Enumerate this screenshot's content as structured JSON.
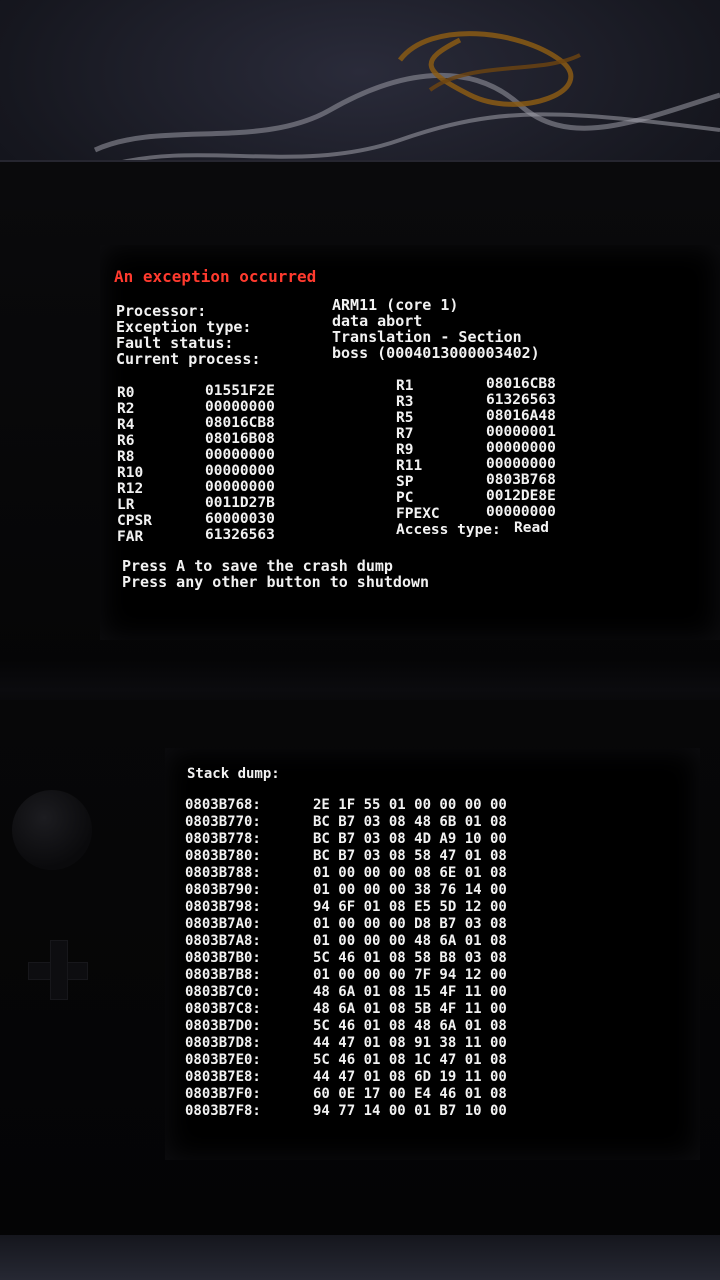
{
  "top_screen": {
    "title": "An exception occurred",
    "info": [
      {
        "label": "Processor:",
        "value": "ARM11 (core 1)"
      },
      {
        "label": "Exception type:",
        "value": "data abort"
      },
      {
        "label": "Fault status:",
        "value": "Translation - Section"
      },
      {
        "label": "Current process:",
        "value": "boss (0004013000003402)"
      }
    ],
    "registers_left": [
      {
        "name": "R0",
        "value": "01551F2E"
      },
      {
        "name": "R2",
        "value": "00000000"
      },
      {
        "name": "R4",
        "value": "08016CB8"
      },
      {
        "name": "R6",
        "value": "08016B08"
      },
      {
        "name": "R8",
        "value": "00000000"
      },
      {
        "name": "R10",
        "value": "00000000"
      },
      {
        "name": "R12",
        "value": "00000000"
      },
      {
        "name": "LR",
        "value": "0011D27B"
      },
      {
        "name": "CPSR",
        "value": "60000030"
      },
      {
        "name": "FAR",
        "value": "61326563"
      }
    ],
    "registers_right": [
      {
        "name": "R1",
        "value": "08016CB8"
      },
      {
        "name": "R3",
        "value": "61326563"
      },
      {
        "name": "R5",
        "value": "08016A48"
      },
      {
        "name": "R7",
        "value": "00000001"
      },
      {
        "name": "R9",
        "value": "00000000"
      },
      {
        "name": "R11",
        "value": "00000000"
      },
      {
        "name": "SP",
        "value": "0803B768"
      },
      {
        "name": "PC",
        "value": "0012DE8E"
      },
      {
        "name": "FPEXC",
        "value": "00000000"
      },
      {
        "name": "Access type:",
        "value": "Read"
      }
    ],
    "press_lines": [
      "Press A to save the crash dump",
      "Press any other button to shutdown"
    ]
  },
  "bottom_screen": {
    "title": "Stack dump:",
    "rows": [
      {
        "addr": "0803B768:",
        "bytes": "2E 1F 55 01 00 00 00 00"
      },
      {
        "addr": "0803B770:",
        "bytes": "BC B7 03 08 48 6B 01 08"
      },
      {
        "addr": "0803B778:",
        "bytes": "BC B7 03 08 4D A9 10 00"
      },
      {
        "addr": "0803B780:",
        "bytes": "BC B7 03 08 58 47 01 08"
      },
      {
        "addr": "0803B788:",
        "bytes": "01 00 00 00 08 6E 01 08"
      },
      {
        "addr": "0803B790:",
        "bytes": "01 00 00 00 38 76 14 00"
      },
      {
        "addr": "0803B798:",
        "bytes": "94 6F 01 08 E5 5D 12 00"
      },
      {
        "addr": "0803B7A0:",
        "bytes": "01 00 00 00 D8 B7 03 08"
      },
      {
        "addr": "0803B7A8:",
        "bytes": "01 00 00 00 48 6A 01 08"
      },
      {
        "addr": "0803B7B0:",
        "bytes": "5C 46 01 08 58 B8 03 08"
      },
      {
        "addr": "0803B7B8:",
        "bytes": "01 00 00 00 7F 94 12 00"
      },
      {
        "addr": "0803B7C0:",
        "bytes": "48 6A 01 08 15 4F 11 00"
      },
      {
        "addr": "0803B7C8:",
        "bytes": "48 6A 01 08 5B 4F 11 00"
      },
      {
        "addr": "0803B7D0:",
        "bytes": "5C 46 01 08 48 6A 01 08"
      },
      {
        "addr": "0803B7D8:",
        "bytes": "44 47 01 08 91 38 11 00"
      },
      {
        "addr": "0803B7E0:",
        "bytes": "5C 46 01 08 1C 47 01 08"
      },
      {
        "addr": "0803B7E8:",
        "bytes": "44 47 01 08 6D 19 11 00"
      },
      {
        "addr": "0803B7F0:",
        "bytes": "60 0E 17 00 E4 46 01 08"
      },
      {
        "addr": "0803B7F8:",
        "bytes": "94 77 14 00 01 B7 10 00"
      }
    ]
  }
}
